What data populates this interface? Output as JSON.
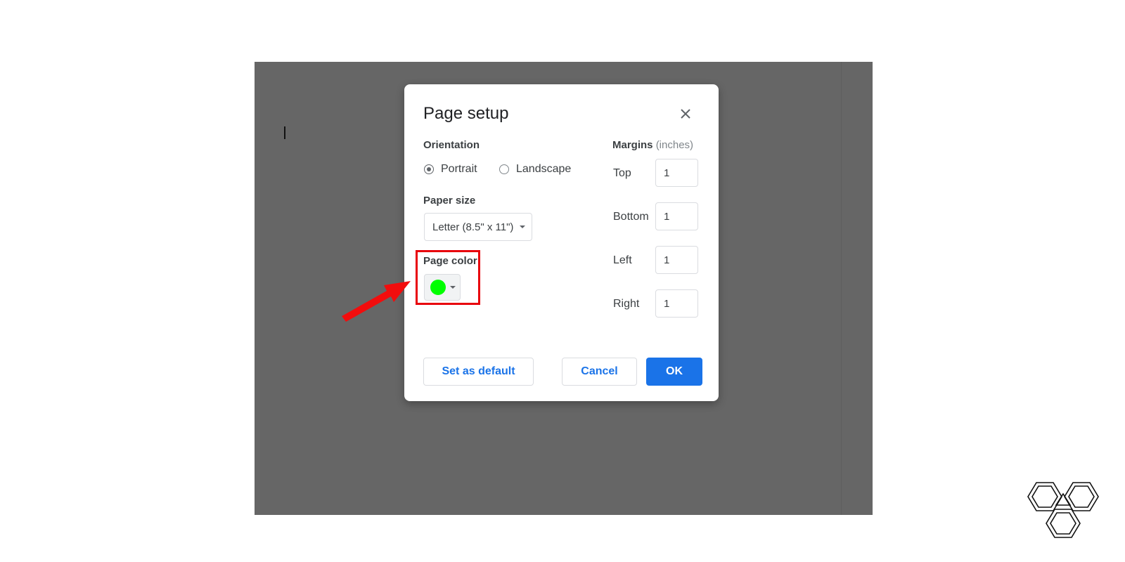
{
  "dialog": {
    "title": "Page setup",
    "orientation": {
      "label": "Orientation",
      "options": [
        "Portrait",
        "Landscape"
      ],
      "selected": "Portrait"
    },
    "paper_size": {
      "label": "Paper size",
      "value": "Letter (8.5\" x 11\")"
    },
    "page_color": {
      "label": "Page color",
      "color": "#00ff00"
    },
    "margins": {
      "label": "Margins",
      "unit": "(inches)",
      "fields": [
        {
          "label": "Top",
          "value": "1"
        },
        {
          "label": "Bottom",
          "value": "1"
        },
        {
          "label": "Left",
          "value": "1"
        },
        {
          "label": "Right",
          "value": "1"
        }
      ]
    },
    "buttons": {
      "set_default": "Set as default",
      "cancel": "Cancel",
      "ok": "OK"
    }
  },
  "icons": {
    "close": "close-icon",
    "arrow": "red-arrow-icon",
    "logo": "hexagon-logo"
  },
  "colors": {
    "accent": "#1a73e8",
    "highlight": "#e8000b",
    "backdrop": "#666666"
  }
}
